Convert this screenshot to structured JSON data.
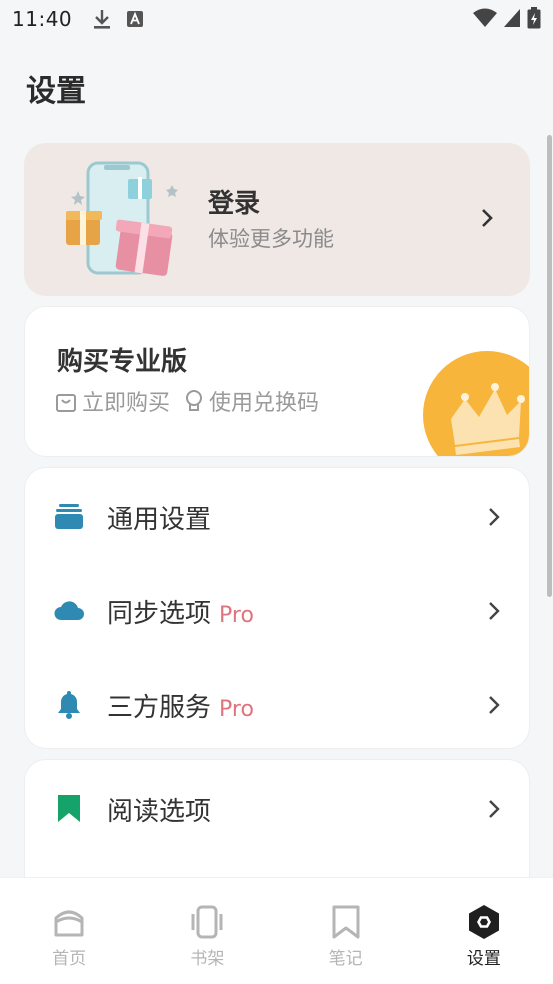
{
  "status_bar": {
    "time": "11:40",
    "left_icons": [
      "download-icon",
      "a-badge-icon"
    ],
    "right_icons": [
      "wifi-icon",
      "signal-icon",
      "battery-icon"
    ]
  },
  "page": {
    "title": "设置"
  },
  "login_card": {
    "title": "登录",
    "subtitle": "体验更多功能",
    "bg_color": "#efe8e4"
  },
  "pro_card": {
    "title": "购买专业版",
    "actions": [
      {
        "label": "立即购买",
        "icon": "shopping-bag-icon"
      },
      {
        "label": "使用兑换码",
        "icon": "bulb-icon"
      }
    ],
    "badge_color": "#f7b63b"
  },
  "settings": {
    "items": [
      {
        "label": "通用设置",
        "icon": "layers-icon",
        "pro": "",
        "icon_color": "#2e8ab3"
      },
      {
        "label": "同步选项",
        "icon": "cloud-icon",
        "pro": "Pro",
        "icon_color": "#2e8ab3"
      },
      {
        "label": "三方服务",
        "icon": "bell-icon",
        "pro": "Pro",
        "icon_color": "#2e8ab3"
      }
    ]
  },
  "reading": {
    "label": "阅读选项",
    "icon": "bookmark-icon",
    "icon_color": "#16a36a"
  },
  "bottom_nav": {
    "items": [
      {
        "label": "首页",
        "icon": "home-icon"
      },
      {
        "label": "书架",
        "icon": "bookshelf-icon"
      },
      {
        "label": "笔记",
        "icon": "bookmark-outline-icon"
      },
      {
        "label": "设置",
        "icon": "hexagon-settings-icon",
        "active": true
      }
    ]
  },
  "colors": {
    "accent_pro": "#e0747e",
    "background": "#f5f6f8"
  }
}
